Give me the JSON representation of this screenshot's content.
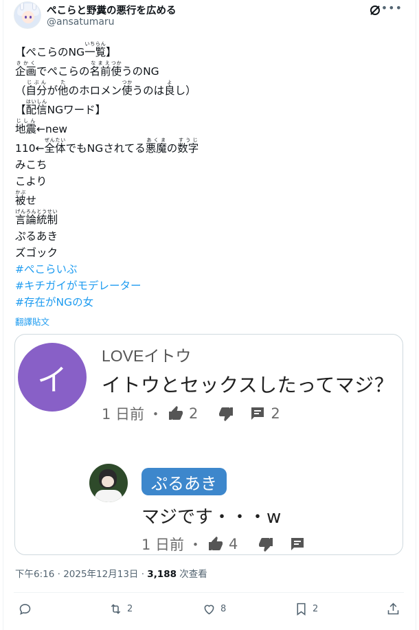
{
  "header": {
    "display_name": "ぺこらと野糞の悪行を広める",
    "handle": "@ansatumaru",
    "grok_icon": "grok-icon",
    "more_icon": "more-dots-icon"
  },
  "tweet": {
    "lines": [
      {
        "text": "【ぺこらのNG一覧】"
      },
      {
        "text": "企画でぺこらの名前使うのNG"
      },
      {
        "text": "（自分が他のホロメン使うのは良し）"
      },
      {
        "text": "【配信NGワード】"
      },
      {
        "text": "地震←new"
      },
      {
        "text": "110←全体でもNGされてる悪魔の数字"
      },
      {
        "text": "みこち"
      },
      {
        "text": "こより"
      },
      {
        "text": "被せ"
      },
      {
        "text": "言論統制"
      },
      {
        "text": "ぷるあき"
      },
      {
        "text": "ズゴック"
      }
    ],
    "hashtags": [
      "#ぺこらいぶ",
      "#キチガイがモデレーター",
      "#存在がNGの女"
    ],
    "furigana": {
      "ichiran": "いちらん",
      "kikaku": "きかく",
      "namae": "なまえ",
      "tsuka1": "つか",
      "jibun": "じぶん",
      "ta": "た",
      "tsuka2": "つか",
      "yo": "よ",
      "haishin": "はいしん",
      "jishin": "じしん",
      "zentai": "ぜんたい",
      "akuma": "あくま",
      "suuji": "すうじ",
      "kabu": "かぶ",
      "genrontousei": "げんろんとうせい"
    },
    "translate_label": "翻譯貼文"
  },
  "media": {
    "comment1": {
      "avatar_letter": "イ",
      "author": "LOVEイトウ",
      "text": "イトウとセックスしたってマジ？",
      "time": "1 日前",
      "likes": "2",
      "replies": "2"
    },
    "comment2": {
      "author": "ぷるあき",
      "text": "マジです・・・w",
      "time": "1 日前",
      "likes": "4"
    }
  },
  "meta": {
    "time": "下午6:16",
    "date": "2025年12月13日",
    "views": "3,188",
    "views_label": "次查看"
  },
  "actions": {
    "replies": "",
    "retweets": "2",
    "likes": "8",
    "bookmarks": "2"
  },
  "colors": {
    "accent": "#1d9bf0",
    "text": "#0f1419",
    "secondary": "#536471",
    "comment_avatar": "#8860c7",
    "reply_badge": "#3d87cc"
  }
}
